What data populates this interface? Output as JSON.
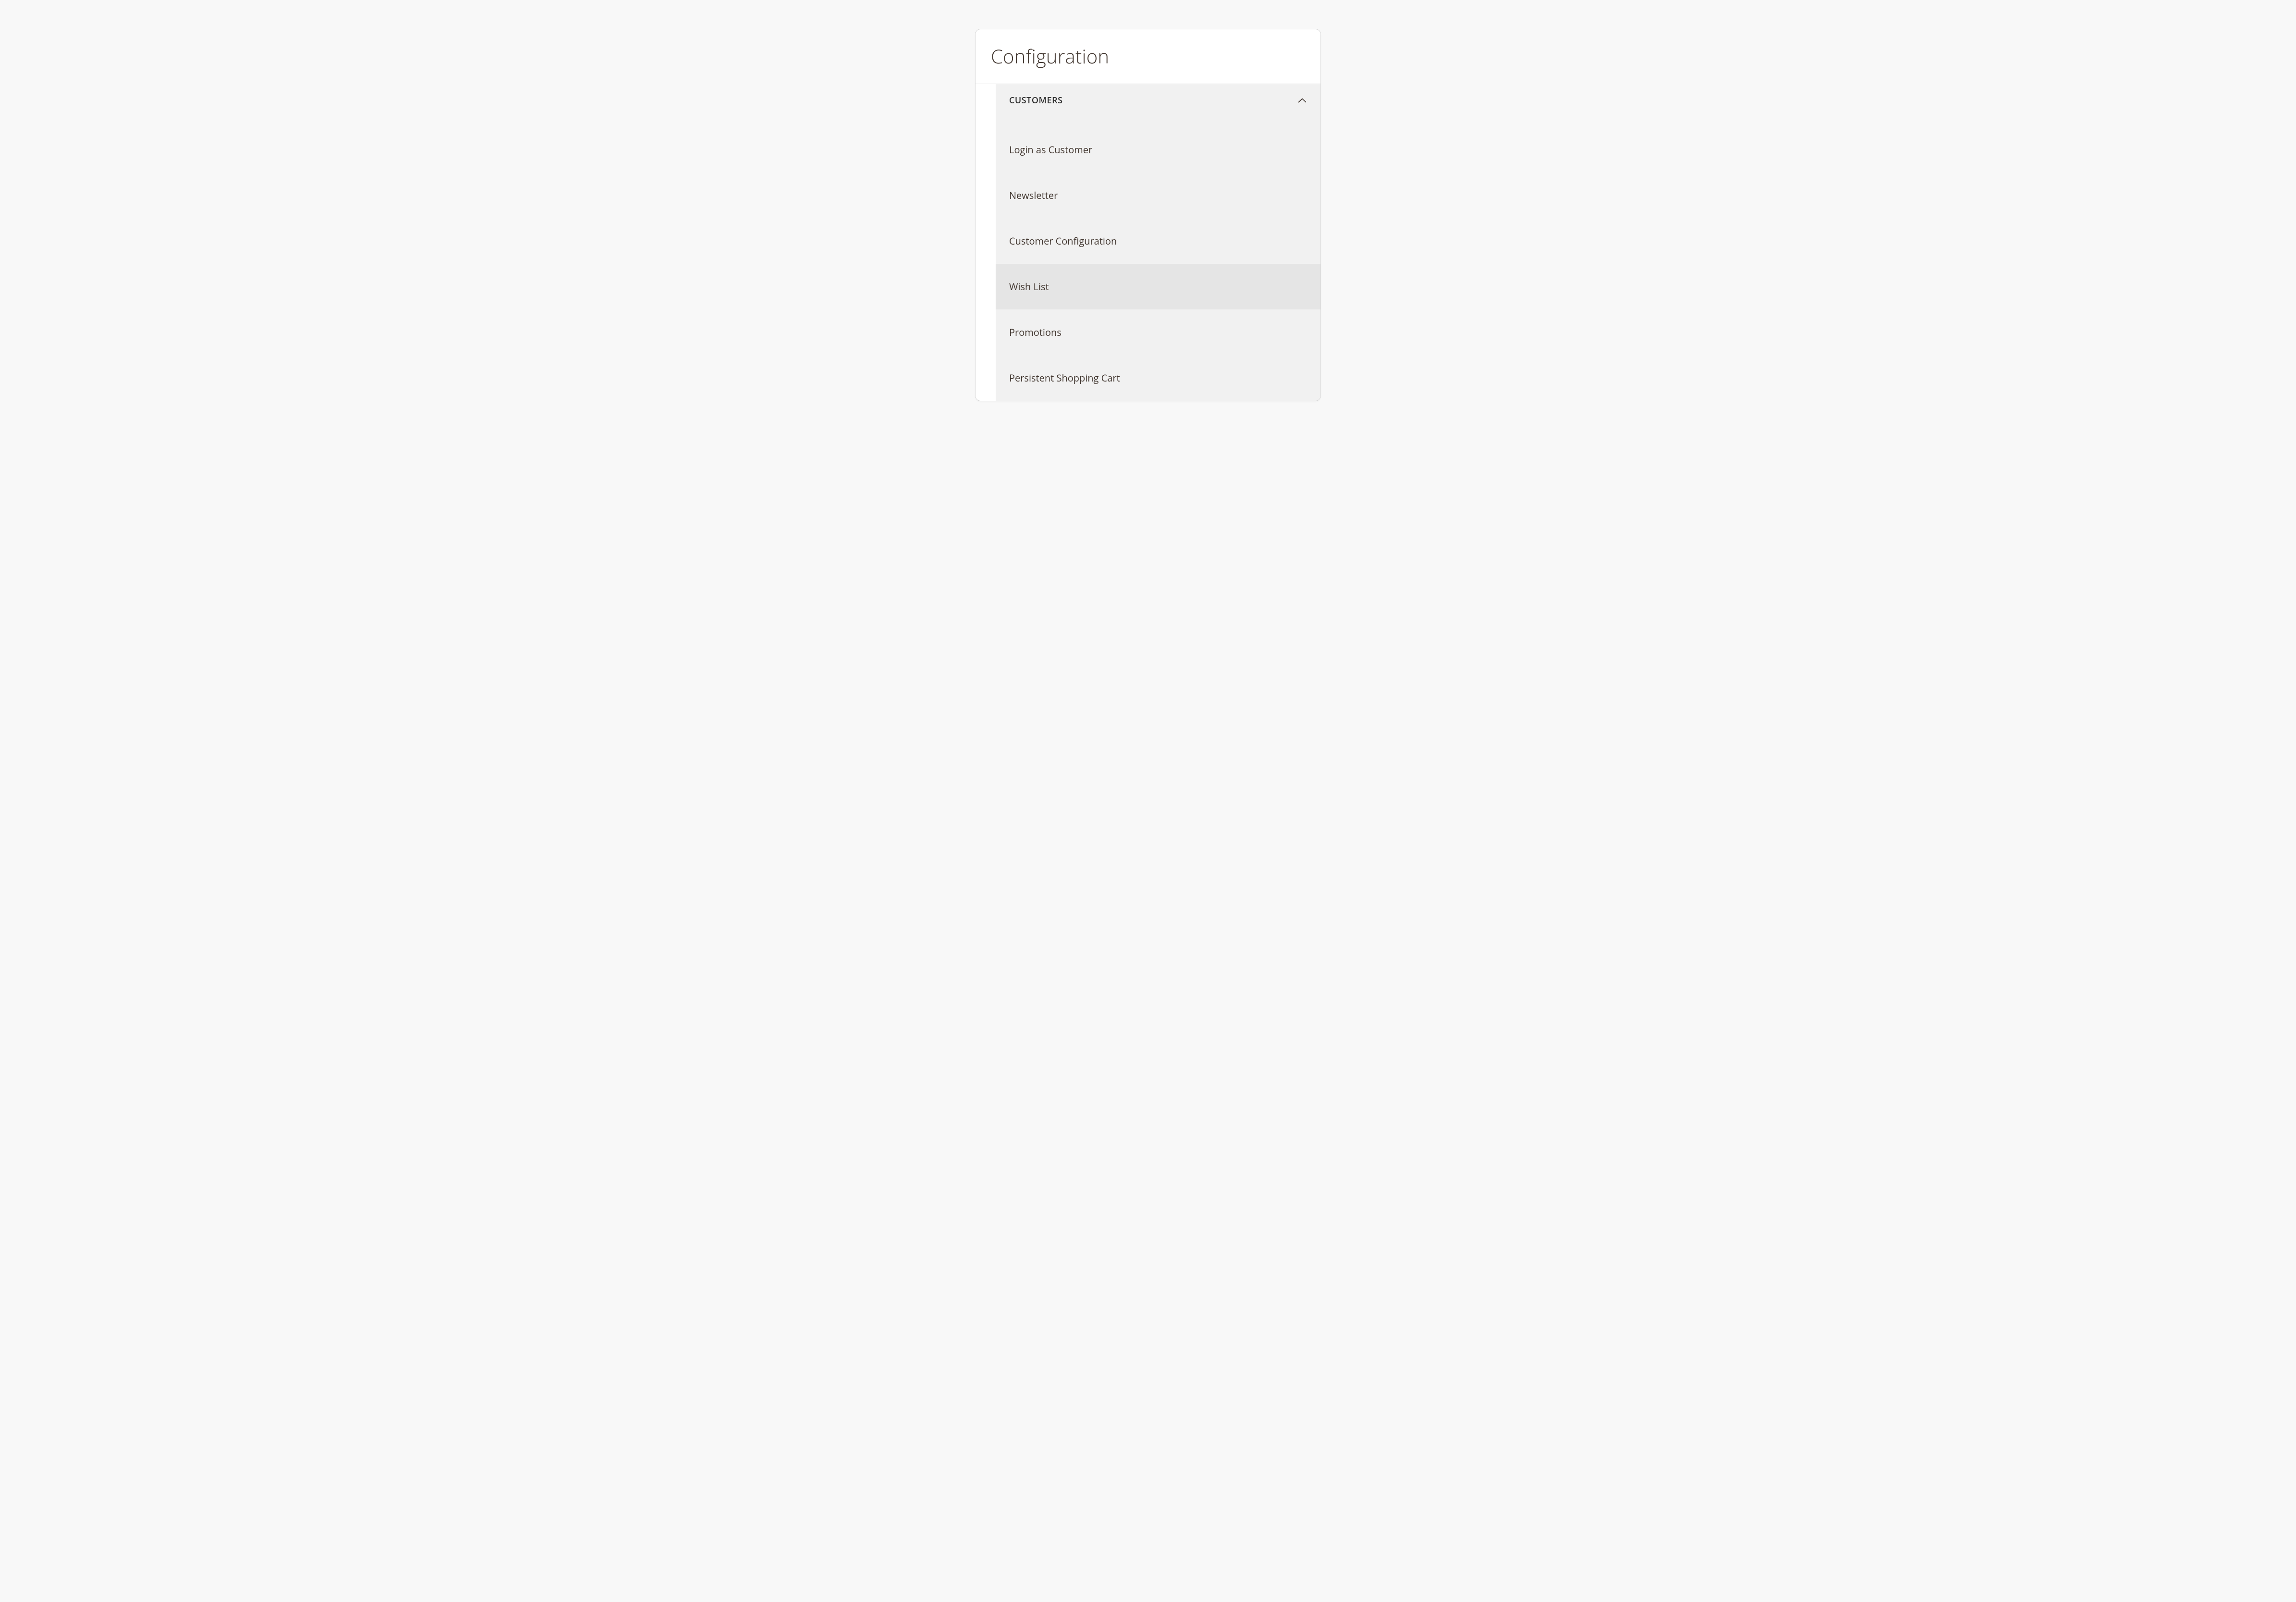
{
  "panel": {
    "title": "Configuration"
  },
  "section": {
    "header": "Customers",
    "expanded": true,
    "items": [
      {
        "label": "Login as Customer",
        "selected": false
      },
      {
        "label": "Newsletter",
        "selected": false
      },
      {
        "label": "Customer Configuration",
        "selected": false
      },
      {
        "label": "Wish List",
        "selected": true
      },
      {
        "label": "Promotions",
        "selected": false
      },
      {
        "label": "Persistent Shopping Cart",
        "selected": false
      }
    ]
  }
}
